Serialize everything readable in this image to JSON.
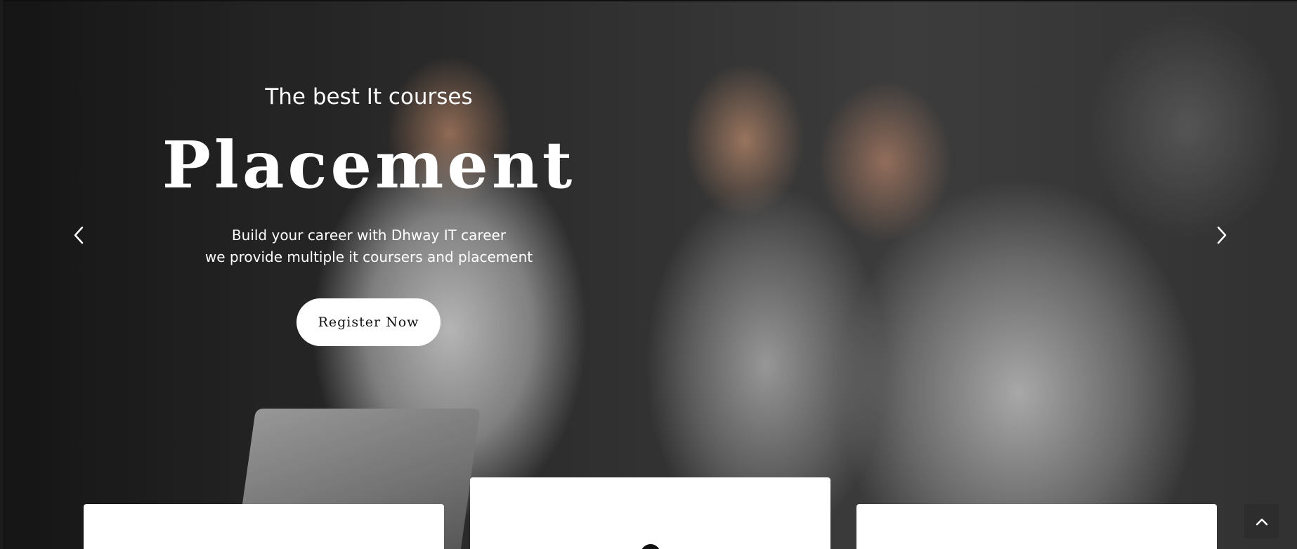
{
  "hero": {
    "subtitle": "The best It courses",
    "headline": "Placement",
    "description_line1": "Build your career with Dhway IT career",
    "description_line2": "we provide multiple it coursers and placement",
    "cta_label": "Register Now"
  },
  "carousel": {
    "prev_icon": "chevron-left-icon",
    "next_icon": "chevron-right-icon"
  },
  "scroll_top": {
    "icon": "chevron-up-icon"
  },
  "colors": {
    "text": "#ffffff",
    "button_bg": "#ffffff",
    "button_text": "#111111",
    "scroll_top_bg": "#2d2d2d"
  }
}
